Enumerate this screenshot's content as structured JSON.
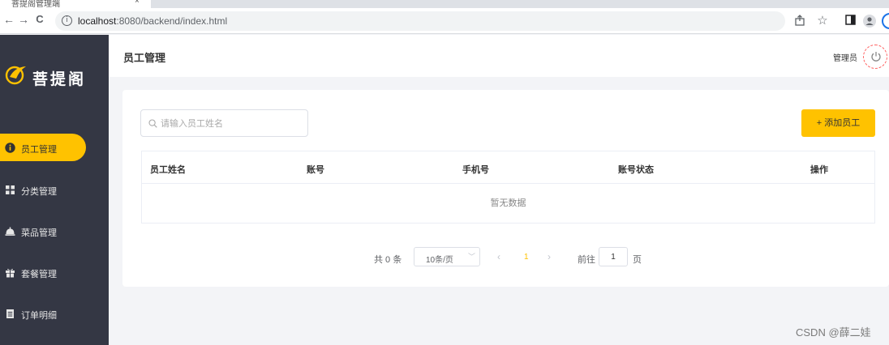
{
  "browser": {
    "tab_title": "菩提阁管理端",
    "tab_close": "×",
    "nav": {
      "back": "←",
      "forward": "→",
      "reload": "C"
    },
    "url_host": "localhost",
    "url_rest": ":8080/backend/index.html"
  },
  "sidebar": {
    "logo_text": "菩提阁",
    "accent_color": "#ffc200",
    "items": [
      {
        "label": "员工管理",
        "icon": "info-circle-icon",
        "active": true
      },
      {
        "label": "分类管理",
        "icon": "grid-icon",
        "active": false
      },
      {
        "label": "菜品管理",
        "icon": "cloche-icon",
        "active": false
      },
      {
        "label": "套餐管理",
        "icon": "gift-icon",
        "active": false
      },
      {
        "label": "订单明细",
        "icon": "document-icon",
        "active": false
      }
    ]
  },
  "header": {
    "title": "员工管理",
    "user": "管理员"
  },
  "toolbar": {
    "search_placeholder": "请输入员工姓名",
    "add_label": "+ 添加员工"
  },
  "table": {
    "columns": [
      "员工姓名",
      "账号",
      "手机号",
      "账号状态",
      "操作"
    ],
    "empty_text": "暂无数据"
  },
  "pager": {
    "total": "共 0 条",
    "page_size": "10条/页",
    "current_page": "1",
    "goto_label": "前往",
    "goto_value": "1",
    "page_suffix": "页"
  },
  "watermark": "CSDN @薛二娃"
}
